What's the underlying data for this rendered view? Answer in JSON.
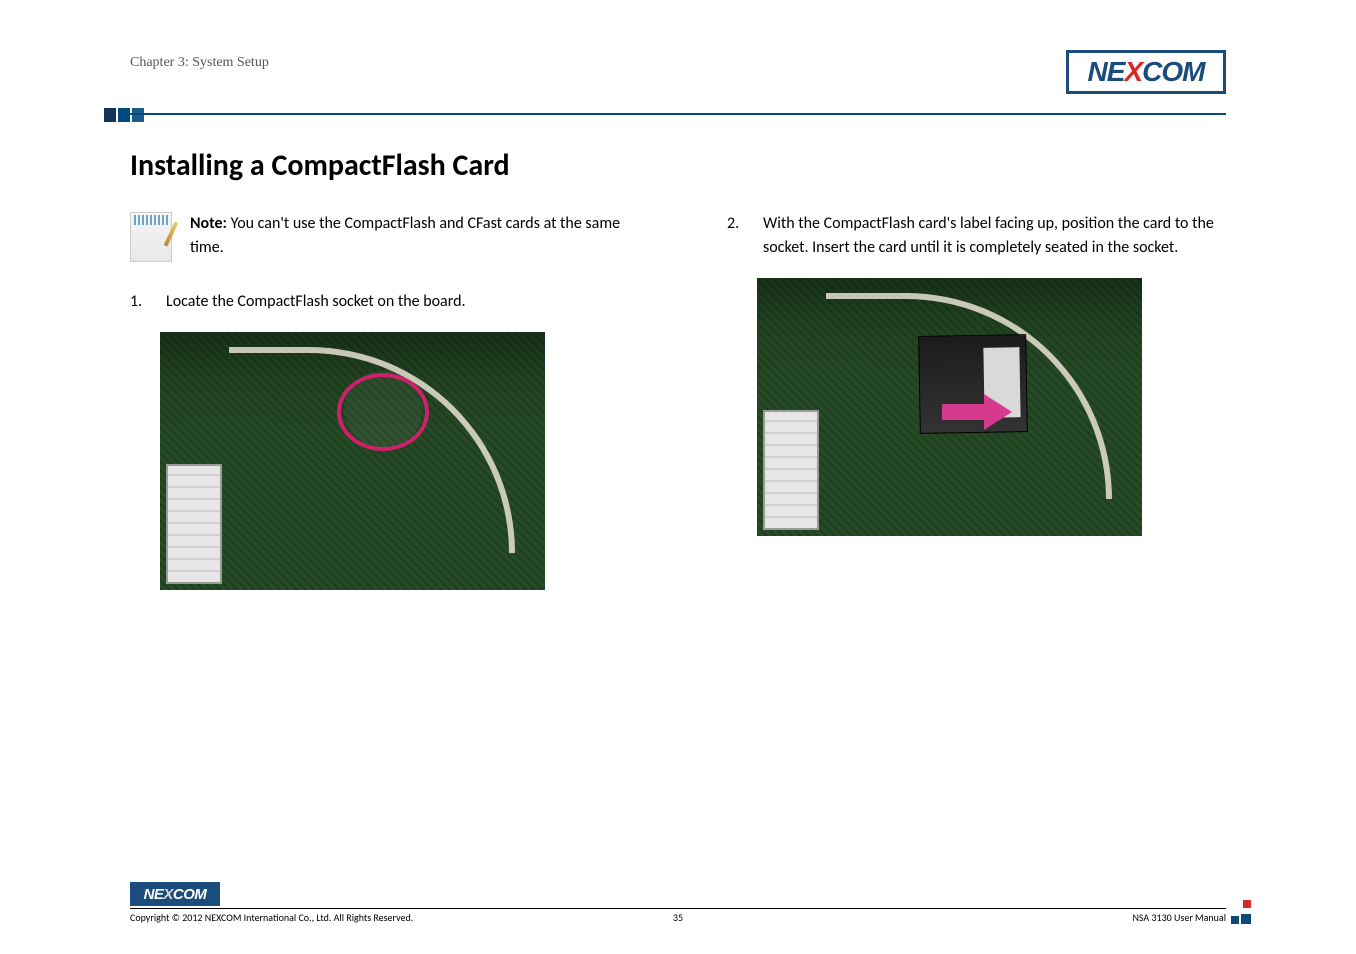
{
  "header": {
    "chapter_label": "Chapter 3: System Setup",
    "brand_ne": "NE",
    "brand_x": "X",
    "brand_com": "COM"
  },
  "main": {
    "heading": "Installing a CompactFlash Card",
    "note_label": "Note:",
    "note_text": " You can't use the CompactFlash and CFast cards at the same time.",
    "step1_num": "1.",
    "step1_text": "Locate the CompactFlash socket on the board.",
    "step2_num": "2.",
    "step2_text": "With the CompactFlash card's label facing up, position the card to the socket. Insert the card until it is completely seated in the socket."
  },
  "footer": {
    "brand_ne": "NE",
    "brand_x": "X",
    "brand_com": "COM",
    "copyright": "Copyright © 2012 NEXCOM International Co., Ltd. All Rights Reserved.",
    "page_number": "35",
    "manual": "NSA 3130 User Manual"
  }
}
